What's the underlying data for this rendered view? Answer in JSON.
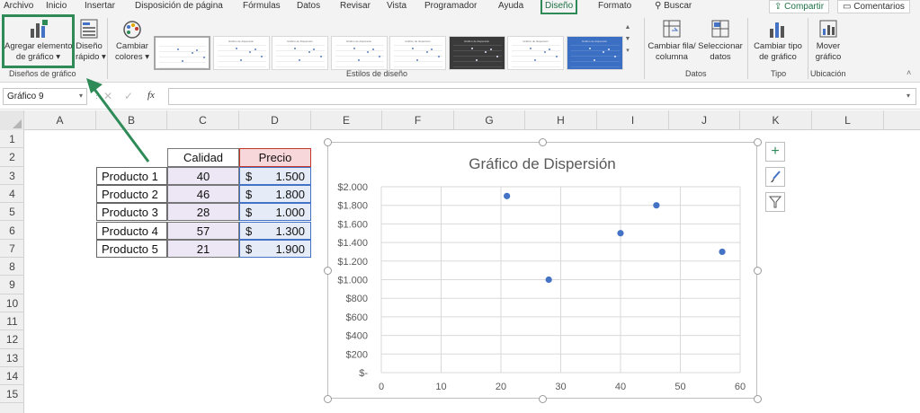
{
  "menu": {
    "items": [
      "Archivo",
      "Inicio",
      "Insertar",
      "Disposición de página",
      "Fórmulas",
      "Datos",
      "Revisar",
      "Vista",
      "Programador",
      "Ayuda",
      "Diseño",
      "Formato"
    ],
    "search": "Buscar",
    "share": "Compartir",
    "comments": "Comentarios"
  },
  "ribbon": {
    "add_element": [
      "Agregar elemento",
      "de gráfico ▾"
    ],
    "quick_layout": [
      "Diseño",
      "rápido ▾"
    ],
    "change_colors": [
      "Cambiar",
      "colores ▾"
    ],
    "switch_row_col": [
      "Cambiar fila/",
      "columna"
    ],
    "select_data": [
      "Seleccionar",
      "datos"
    ],
    "change_type": [
      "Cambiar tipo",
      "de gráfico"
    ],
    "move_chart": [
      "Mover",
      "gráfico"
    ],
    "groups": {
      "layouts": "Diseños de gráfico",
      "styles": "Estilos de diseño",
      "data": "Datos",
      "type": "Tipo",
      "location": "Ubicación"
    },
    "style_thumb_titles": [
      "",
      "Gráfico de dispersión",
      "Gráfico de Dispersión",
      "Gráfico de dispersión",
      "Gráfico de dispersión",
      "Gráfico de dispersión",
      "Gráfico de dispersión",
      "Gráfico de dispersión"
    ]
  },
  "formula_bar": {
    "name_box": "Gráfico 9",
    "fx": "fx",
    "value": ""
  },
  "columns": [
    "A",
    "B",
    "C",
    "D",
    "E",
    "F",
    "G",
    "H",
    "I",
    "J",
    "K",
    "L"
  ],
  "rows": [
    "1",
    "2",
    "3",
    "4",
    "5",
    "6",
    "7",
    "8",
    "9",
    "10",
    "11",
    "12",
    "13",
    "14",
    "15"
  ],
  "table": {
    "header_calidad": "Calidad",
    "header_precio": "Precio",
    "currency": "$",
    "rows": [
      {
        "product": "Producto 1",
        "calidad": "40",
        "precio": "1.500"
      },
      {
        "product": "Producto 2",
        "calidad": "46",
        "precio": "1.800"
      },
      {
        "product": "Producto 3",
        "calidad": "28",
        "precio": "1.000"
      },
      {
        "product": "Producto 4",
        "calidad": "57",
        "precio": "1.300"
      },
      {
        "product": "Producto 5",
        "calidad": "21",
        "precio": "1.900"
      }
    ]
  },
  "colors": {
    "accent_green": "#2e8b57",
    "point_blue": "#4472c4",
    "precio_header_bg": "#f8d7da",
    "calidad_bg": "#ede7f5",
    "precio_bg": "#e6ecf7"
  },
  "chart_data": {
    "type": "scatter",
    "title": "Gráfico de Dispersión",
    "x": [
      40,
      46,
      28,
      57,
      21
    ],
    "y": [
      1500,
      1800,
      1000,
      1300,
      1900
    ],
    "xlim": [
      0,
      60
    ],
    "ylim": [
      0,
      2000
    ],
    "x_ticks": [
      "0",
      "10",
      "20",
      "30",
      "40",
      "50",
      "60"
    ],
    "y_ticks": [
      "$-",
      "$200",
      "$400",
      "$600",
      "$800",
      "$1.000",
      "$1.200",
      "$1.400",
      "$1.600",
      "$1.800",
      "$2.000"
    ],
    "grid": true,
    "legend": "none"
  }
}
